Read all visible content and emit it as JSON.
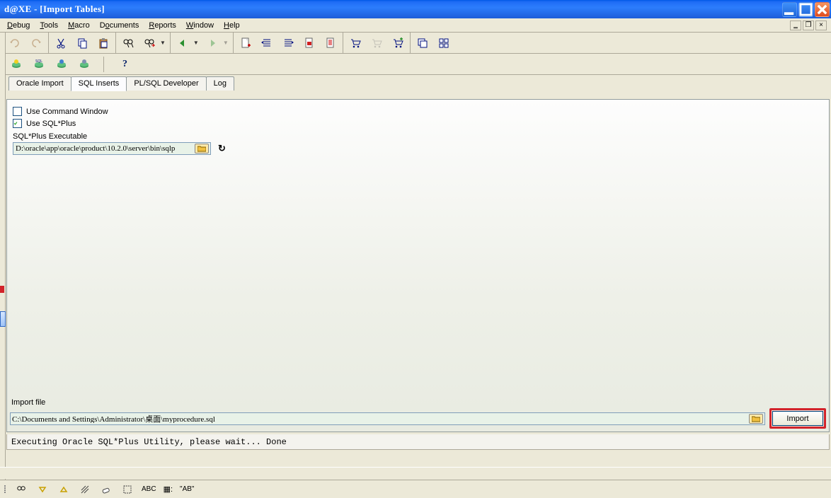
{
  "title": "d@XE - [Import Tables]",
  "menu": {
    "items": [
      "Debug",
      "Tools",
      "Macro",
      "Documents",
      "Reports",
      "Window",
      "Help"
    ],
    "accel": [
      "D",
      "T",
      "M",
      "D",
      "R",
      "W",
      "H"
    ]
  },
  "tabs": {
    "items": [
      "Oracle Import",
      "SQL Inserts",
      "PL/SQL Developer",
      "Log"
    ],
    "active": 1
  },
  "form": {
    "use_command_window": {
      "label": "Use Command Window",
      "checked": false
    },
    "use_sqlplus": {
      "label": "Use SQL*Plus",
      "checked": true
    },
    "sqlplus_exe_label": "SQL*Plus Executable",
    "sqlplus_path": "D:\\oracle\\app\\oracle\\product\\10.2.0\\server\\bin\\sqlp",
    "import_file_label": "Import file",
    "import_file_path": "C:\\Documents and Settings\\Administrator\\桌面\\myprocedure.sql",
    "import_button": "Import"
  },
  "status": "Executing Oracle SQL*Plus Utility, please wait... Done",
  "bottom_toolbar": {
    "abc": "ABC",
    "boxed": "▦:",
    "ab": "\"AB\""
  }
}
